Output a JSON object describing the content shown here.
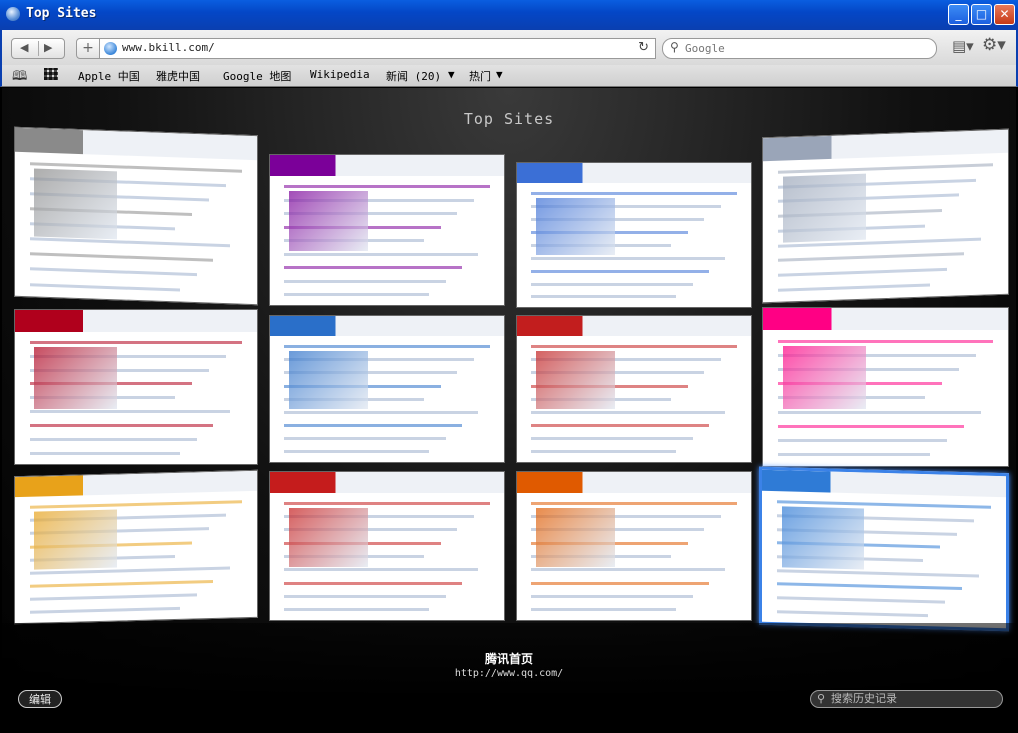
{
  "window": {
    "title": "Top Sites"
  },
  "toolbar": {
    "url": "www.bkill.com/",
    "search_placeholder": "Google"
  },
  "bookmarks": [
    {
      "label": "Apple 中国"
    },
    {
      "label": "雅虎中国"
    },
    {
      "label": "Google 地图"
    },
    {
      "label": "Wikipedia"
    },
    {
      "label": "新闻 (20)",
      "menu": true
    },
    {
      "label": "热门",
      "menu": true
    }
  ],
  "main": {
    "heading": "Top Sites",
    "selected_site": {
      "title": "腾讯首页",
      "url": "http://www.qq.com/"
    },
    "edit_label": "编辑",
    "history_search_placeholder": "搜索历史记录",
    "tiles": [
      {
        "name": "apple-china",
        "accent": "#8a8a8a"
      },
      {
        "name": "yahoo-china",
        "accent": "#7b0099"
      },
      {
        "name": "google-maps",
        "accent": "#3b6fd6"
      },
      {
        "name": "wikipedia",
        "accent": "#9aa5b8"
      },
      {
        "name": "news-site-1",
        "accent": "#b0001c"
      },
      {
        "name": "shopping-site",
        "accent": "#2a6fc9"
      },
      {
        "name": "news-site-2",
        "accent": "#c21e1e"
      },
      {
        "name": "flickr",
        "accent": "#ff0084"
      },
      {
        "name": "sohu",
        "accent": "#e8a21a"
      },
      {
        "name": "sina",
        "accent": "#c51c1c"
      },
      {
        "name": "163",
        "accent": "#e05a00"
      },
      {
        "name": "qq",
        "accent": "#2f7bd6"
      }
    ]
  }
}
